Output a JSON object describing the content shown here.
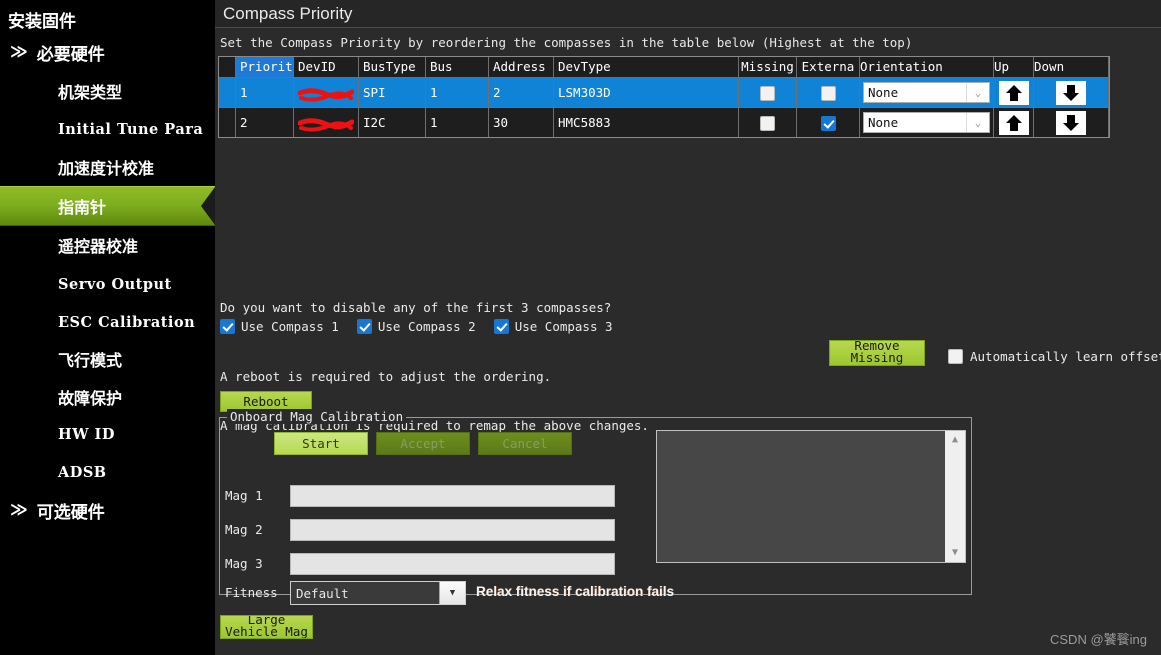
{
  "window": {
    "title": "Compass Priority"
  },
  "sidebar": {
    "items": [
      {
        "label": "安装固件",
        "level": 0,
        "mono": false,
        "selected": false,
        "chevron": ""
      },
      {
        "label": "必要硬件",
        "level": 1,
        "mono": false,
        "selected": false,
        "chevron": "≫"
      },
      {
        "label": "机架类型",
        "level": 2,
        "mono": false,
        "selected": false,
        "chevron": ""
      },
      {
        "label": "Initial Tune Para",
        "level": 2,
        "mono": true,
        "selected": false,
        "chevron": ""
      },
      {
        "label": "加速度计校准",
        "level": 2,
        "mono": false,
        "selected": false,
        "chevron": ""
      },
      {
        "label": "指南针",
        "level": 2,
        "mono": false,
        "selected": true,
        "chevron": ""
      },
      {
        "label": "遥控器校准",
        "level": 2,
        "mono": false,
        "selected": false,
        "chevron": ""
      },
      {
        "label": "Servo Output",
        "level": 2,
        "mono": true,
        "selected": false,
        "chevron": ""
      },
      {
        "label": "ESC Calibration",
        "level": 2,
        "mono": true,
        "selected": false,
        "chevron": ""
      },
      {
        "label": "飞行模式",
        "level": 2,
        "mono": false,
        "selected": false,
        "chevron": ""
      },
      {
        "label": "故障保护",
        "level": 2,
        "mono": false,
        "selected": false,
        "chevron": ""
      },
      {
        "label": "HW ID",
        "level": 2,
        "mono": true,
        "selected": false,
        "chevron": ""
      },
      {
        "label": "ADSB",
        "level": 2,
        "mono": true,
        "selected": false,
        "chevron": ""
      },
      {
        "label": "可选硬件",
        "level": 1,
        "mono": false,
        "selected": false,
        "chevron": "≫"
      }
    ]
  },
  "main": {
    "hint": "Set the Compass Priority by reordering the compasses in the table below (Highest at the top)",
    "table": {
      "columns": [
        "",
        "Priorit",
        "DevID",
        "BusType",
        "Bus",
        "Address",
        "DevType",
        "Missing",
        "Externa",
        "Orientation",
        "Up",
        "Down"
      ],
      "selected_header": "Priorit",
      "rows": [
        {
          "priority": "1",
          "devid": "",
          "devid_redacted": true,
          "bustype": "SPI",
          "bus": "1",
          "address": "2",
          "devtype": "LSM303D",
          "missing": false,
          "external": false,
          "orientation": "None",
          "selected": true
        },
        {
          "priority": "2",
          "devid": "",
          "devid_redacted": true,
          "bustype": "I2C",
          "bus": "1",
          "address": "30",
          "devtype": "HMC5883",
          "missing": false,
          "external": true,
          "orientation": "None",
          "selected": false
        }
      ]
    },
    "disable_question": "Do you want to disable any of the first 3 compasses?",
    "use_compass": [
      {
        "label": "Use Compass 1",
        "checked": true
      },
      {
        "label": "Use Compass 2",
        "checked": true
      },
      {
        "label": "Use Compass 3",
        "checked": true
      }
    ],
    "remove_missing_button": {
      "line1": "Remove",
      "line2": "Missing"
    },
    "auto_learn": {
      "label": "Automatically learn offsets",
      "checked": false
    },
    "reboot_note": "A reboot is required to adjust the ordering.",
    "reboot_button": "Reboot",
    "magcal_note": "A mag calibration is required to remap the above changes.",
    "groupbox": {
      "legend": "Onboard Mag Calibration",
      "start_button": "Start",
      "accept_button": "Accept",
      "cancel_button": "Cancel",
      "accept_enabled": false,
      "cancel_enabled": false,
      "mag_rows": [
        {
          "label": "Mag 1",
          "value": ""
        },
        {
          "label": "Mag 2",
          "value": ""
        },
        {
          "label": "Mag 3",
          "value": ""
        }
      ],
      "fitness_label": "Fitness",
      "fitness_value": "Default",
      "relax_text": "Relax fitness if calibration fails",
      "log_text": ""
    },
    "large_vehicle_button": {
      "line1": "Large",
      "line2": "Vehicle Mag"
    }
  },
  "watermark": "CSDN @饕餮ing",
  "colors": {
    "accent_green": "#9cc72f",
    "selection_blue": "#1083d6",
    "sidebar_bg": "#000000",
    "panel_bg": "#2b2b2b"
  }
}
